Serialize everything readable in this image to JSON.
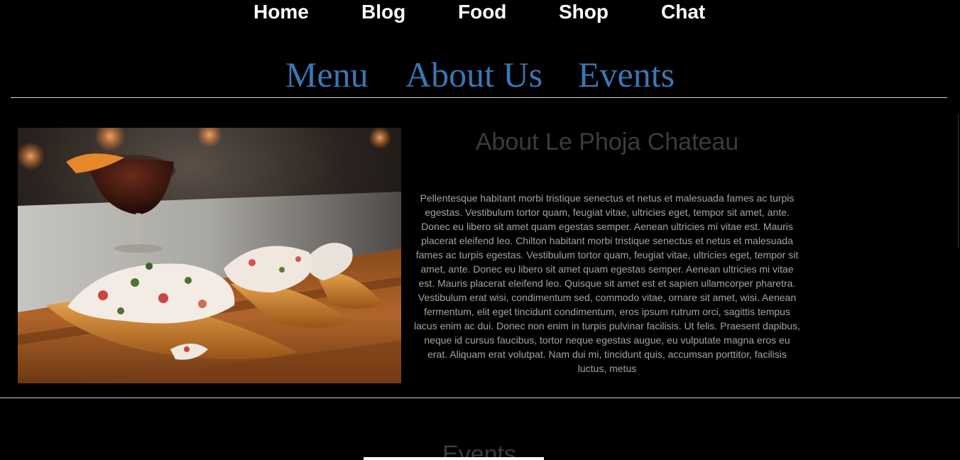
{
  "top_nav": {
    "items": [
      "Home",
      "Blog",
      "Food",
      "Shop",
      "Chat"
    ]
  },
  "sub_nav": {
    "items": [
      "Menu",
      "About Us",
      "Events"
    ]
  },
  "about": {
    "title": "About Le Phoja Chateau",
    "body": "Pellentesque habitant morbi tristique senectus et netus et malesuada fames ac turpis egestas. Vestibulum tortor quam, feugiat vitae, ultricies eget, tempor sit amet, ante. Donec eu libero sit amet quam egestas semper. Aenean ultricies mi vitae est. Mauris placerat eleifend leo. Chilton habitant morbi tristique senectus et netus et malesuada fames ac turpis egestas. Vestibulum tortor quam, feugiat vitae, ultricies eget, tempor sit amet, ante. Donec eu libero sit amet quam egestas semper. Aenean ultricies mi vitae est. Mauris placerat eleifend leo. Quisque sit amet est et sapien ullamcorper pharetra. Vestibulum erat wisi, condimentum sed, commodo vitae, ornare sit amet, wisi. Aenean fermentum, elit eget tincidunt condimentum, eros ipsum rutrum orci, sagittis tempus lacus enim ac dui. Donec non enim in turpis pulvinar facilisis. Ut felis. Praesent dapibus, neque id cursus faucibus, tortor neque egestas augue, eu vulputate magna eros eu erat. Aliquam erat volutpat. Nam dui mi, tincidunt quis, accumsan porttitor, facilisis luctus, metus"
  },
  "events": {
    "title": "Events"
  },
  "colors": {
    "background": "#000000",
    "top_nav_text": "#ffffff",
    "sub_nav_link": "#3a77b5",
    "heading": "#3b3b3b",
    "body_text": "#a3a3a3"
  }
}
